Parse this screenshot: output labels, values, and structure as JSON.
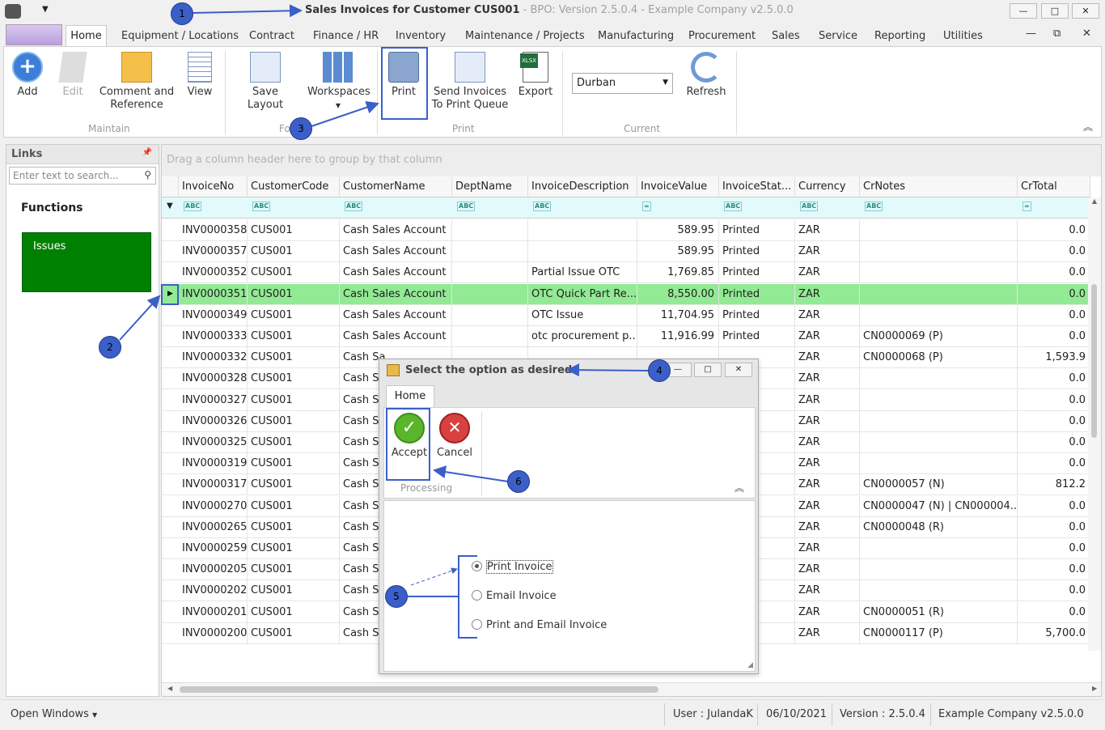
{
  "window": {
    "title_main": "Sales Invoices for Customer CUS001",
    "title_sub": " - BPO: Version 2.5.0.4 - Example Company v2.5.0.0",
    "min": "—",
    "max": "□",
    "close": "✕"
  },
  "menu": {
    "tabs": [
      "Home",
      "Equipment / Locations",
      "Contract",
      "Finance / HR",
      "Inventory",
      "Maintenance / Projects",
      "Manufacturing",
      "Procurement",
      "Sales",
      "Service",
      "Reporting",
      "Utilities"
    ]
  },
  "ribbon": {
    "add": "Add",
    "edit": "Edit",
    "comment_line1": "Comment and",
    "comment_line2": "Reference",
    "view": "View",
    "save_layout": "Save Layout",
    "workspaces": "Workspaces",
    "print": "Print",
    "send_line1": "Send Invoices",
    "send_line2": "To Print Queue",
    "export": "Export",
    "site_value": "Durban",
    "refresh": "Refresh",
    "group_maintain": "Maintain",
    "group_format": "Fo",
    "group_print": "Print",
    "group_current": "Current"
  },
  "links": {
    "title": "Links",
    "search_placeholder": "Enter text to search...",
    "functions": "Functions",
    "issues": "Issues"
  },
  "grid": {
    "group_hint": "Drag a column header here to group by that column",
    "columns": [
      "InvoiceNo",
      "CustomerCode",
      "CustomerName",
      "DeptName",
      "InvoiceDescription",
      "InvoiceValue",
      "InvoiceStat...",
      "Currency",
      "CrNotes",
      "CrTotal"
    ],
    "rows": [
      [
        "INV0000358",
        "CUS001",
        "Cash Sales Account",
        "",
        "",
        "589.95",
        "Printed",
        "ZAR",
        "",
        "0.0"
      ],
      [
        "INV0000357",
        "CUS001",
        "Cash Sales Account",
        "",
        "",
        "589.95",
        "Printed",
        "ZAR",
        "",
        "0.0"
      ],
      [
        "INV0000352",
        "CUS001",
        "Cash Sales Account",
        "",
        "Partial Issue OTC",
        "1,769.85",
        "Printed",
        "ZAR",
        "",
        "0.0"
      ],
      [
        "INV0000351",
        "CUS001",
        "Cash Sales Account",
        "",
        "OTC Quick Part Re...",
        "8,550.00",
        "Printed",
        "ZAR",
        "",
        "0.0"
      ],
      [
        "INV0000349",
        "CUS001",
        "Cash Sales Account",
        "",
        "OTC Issue",
        "11,704.95",
        "Printed",
        "ZAR",
        "",
        "0.0"
      ],
      [
        "INV0000333",
        "CUS001",
        "Cash Sales Account",
        "",
        "otc procurement p...",
        "11,916.99",
        "Printed",
        "ZAR",
        "CN0000069 (P)",
        "0.0"
      ],
      [
        "INV0000332",
        "CUS001",
        "Cash Sa",
        "",
        "",
        "",
        "",
        "ZAR",
        "CN0000068 (P)",
        "1,593.9"
      ],
      [
        "INV0000328",
        "CUS001",
        "Cash Sa",
        "",
        "",
        "",
        "",
        "ZAR",
        "",
        "0.0"
      ],
      [
        "INV0000327",
        "CUS001",
        "Cash Sa",
        "",
        "",
        "",
        "",
        "ZAR",
        "",
        "0.0"
      ],
      [
        "INV0000326",
        "CUS001",
        "Cash Sa",
        "",
        "",
        "",
        "",
        "ZAR",
        "",
        "0.0"
      ],
      [
        "INV0000325",
        "CUS001",
        "Cash Sa",
        "",
        "",
        "",
        "",
        "ZAR",
        "",
        "0.0"
      ],
      [
        "INV0000319",
        "CUS001",
        "Cash Sa",
        "",
        "",
        "",
        "",
        "ZAR",
        "",
        "0.0"
      ],
      [
        "INV0000317",
        "CUS001",
        "Cash Sa",
        "",
        "",
        "",
        "",
        "ZAR",
        "CN0000057 (N)",
        "812.2"
      ],
      [
        "INV0000270",
        "CUS001",
        "Cash Sa",
        "",
        "",
        "",
        "",
        "ZAR",
        "CN0000047 (N) | CN000004...",
        "0.0"
      ],
      [
        "INV0000265",
        "CUS001",
        "Cash Sa",
        "",
        "",
        "",
        "",
        "ZAR",
        "CN0000048 (R)",
        "0.0"
      ],
      [
        "INV0000259",
        "CUS001",
        "Cash Sa",
        "",
        "",
        "",
        "",
        "ZAR",
        "",
        "0.0"
      ],
      [
        "INV0000205",
        "CUS001",
        "Cash Sa",
        "",
        "",
        "",
        "",
        "ZAR",
        "",
        "0.0"
      ],
      [
        "INV0000202",
        "CUS001",
        "Cash Sa",
        "",
        "",
        "",
        "",
        "ZAR",
        "",
        "0.0"
      ],
      [
        "INV0000201",
        "CUS001",
        "Cash Sa",
        "",
        "",
        "",
        "",
        "ZAR",
        "CN0000051 (R)",
        "0.0"
      ],
      [
        "INV0000200",
        "CUS001",
        "Cash Sa",
        "",
        "",
        "",
        "",
        "ZAR",
        "CN0000117 (P)",
        "5,700.0"
      ]
    ]
  },
  "dialog": {
    "title": "Select the option as desired",
    "tab": "Home",
    "accept": "Accept",
    "cancel": "Cancel",
    "group": "Processing",
    "options": [
      "Print Invoice",
      "Email Invoice",
      "Print and Email Invoice"
    ],
    "selected_option": "Print Invoice"
  },
  "status": {
    "open_windows": "Open Windows",
    "user": "User : JulandaK",
    "date": "06/10/2021",
    "version": "Version : 2.5.0.4",
    "company": "Example Company v2.5.0.0"
  },
  "callouts": [
    "1",
    "2",
    "3",
    "4",
    "5",
    "6"
  ],
  "colors": {
    "selected_row": "#92ea94",
    "issues_tile": "#008000",
    "callout": "#3b5fc9"
  }
}
